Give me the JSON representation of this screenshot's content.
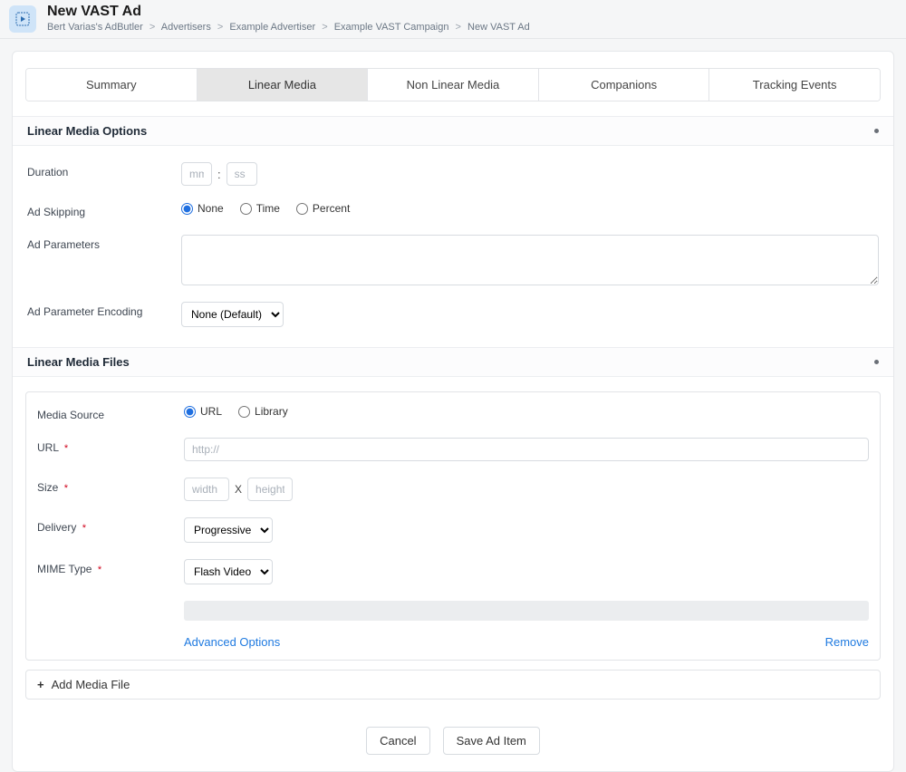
{
  "header": {
    "page_title": "New VAST Ad",
    "breadcrumb": [
      "Bert Varias's AdButler",
      "Advertisers",
      "Example Advertiser",
      "Example VAST Campaign",
      "New VAST Ad"
    ]
  },
  "tabs": [
    {
      "label": "Summary",
      "active": false
    },
    {
      "label": "Linear Media",
      "active": true
    },
    {
      "label": "Non Linear Media",
      "active": false
    },
    {
      "label": "Companions",
      "active": false
    },
    {
      "label": "Tracking Events",
      "active": false
    }
  ],
  "sections": {
    "options": {
      "title": "Linear Media Options",
      "fields": {
        "duration": {
          "label": "Duration",
          "mm_placeholder": "mm",
          "ss_placeholder": "ss"
        },
        "ad_skipping": {
          "label": "Ad Skipping",
          "options": [
            "None",
            "Time",
            "Percent"
          ],
          "selected": "None"
        },
        "ad_parameters": {
          "label": "Ad Parameters",
          "value": ""
        },
        "encoding": {
          "label": "Ad Parameter Encoding",
          "options": [
            "None (Default)"
          ],
          "selected": "None (Default)"
        }
      }
    },
    "files": {
      "title": "Linear Media Files",
      "file": {
        "media_source": {
          "label": "Media Source",
          "options": [
            "URL",
            "Library"
          ],
          "selected": "URL"
        },
        "url": {
          "label": "URL",
          "placeholder": "http://",
          "required_marker": "*"
        },
        "size": {
          "label": "Size",
          "required_marker": "*",
          "width_placeholder": "width",
          "height_placeholder": "height",
          "separator": "X"
        },
        "delivery": {
          "label": "Delivery",
          "required_marker": "*",
          "options": [
            "Progressive"
          ],
          "selected": "Progressive"
        },
        "mime": {
          "label": "MIME Type",
          "required_marker": "*",
          "options": [
            "Flash Video"
          ],
          "selected": "Flash Video"
        },
        "advanced_link": "Advanced Options",
        "remove_link": "Remove"
      },
      "add_file_label": "Add Media File"
    }
  },
  "footer": {
    "cancel": "Cancel",
    "save": "Save Ad Item"
  }
}
